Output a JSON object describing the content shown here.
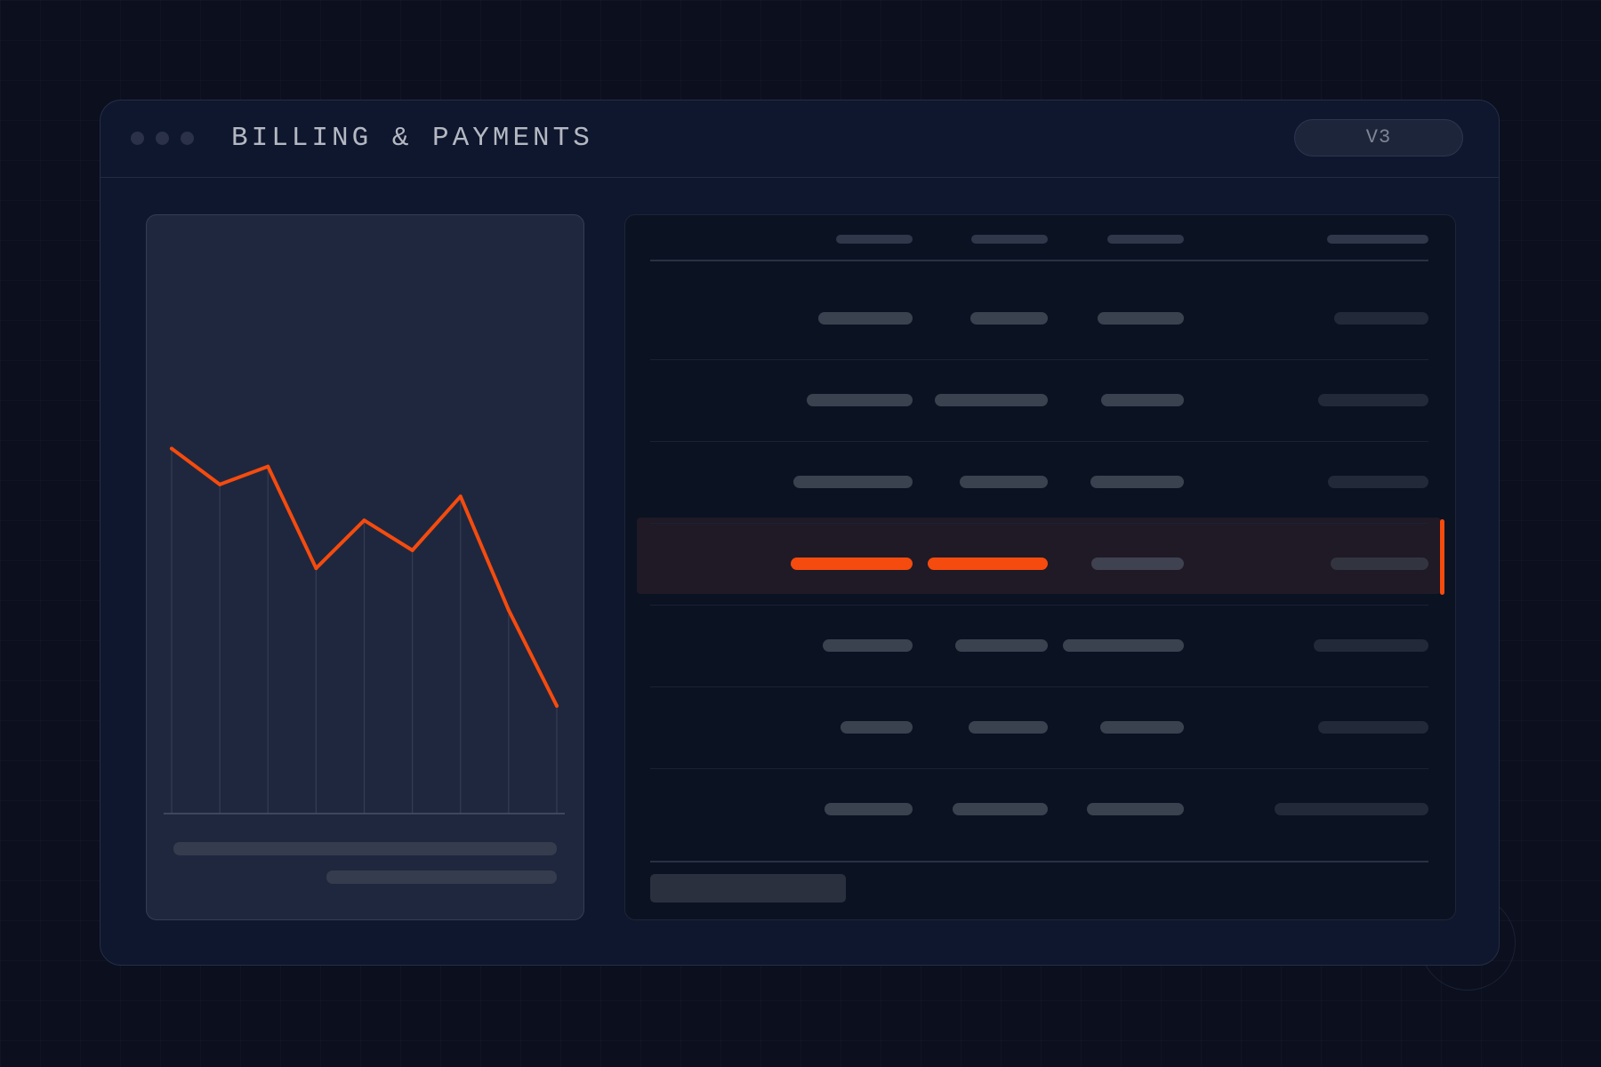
{
  "window": {
    "title": "BILLING & PAYMENTS",
    "version_badge": "V3"
  },
  "colors": {
    "background": "#0b0f1e",
    "window": "#0f172e",
    "chart_card": "#1f273e",
    "table_card": "#0b1222",
    "accent": "#f54b0e",
    "placeholder": "#3a414f"
  },
  "chart_data": {
    "type": "line",
    "x": [
      1,
      2,
      3,
      4,
      5,
      6,
      7,
      8,
      9
    ],
    "series": [
      {
        "values": [
          61,
          55,
          58,
          41,
          49,
          44,
          53,
          34,
          18
        ]
      }
    ],
    "ylim": [
      0,
      100
    ],
    "grid": "vertical",
    "color": "#f54b0e"
  },
  "table": {
    "columns": 4,
    "row_count": 7,
    "highlighted_row": 3
  }
}
